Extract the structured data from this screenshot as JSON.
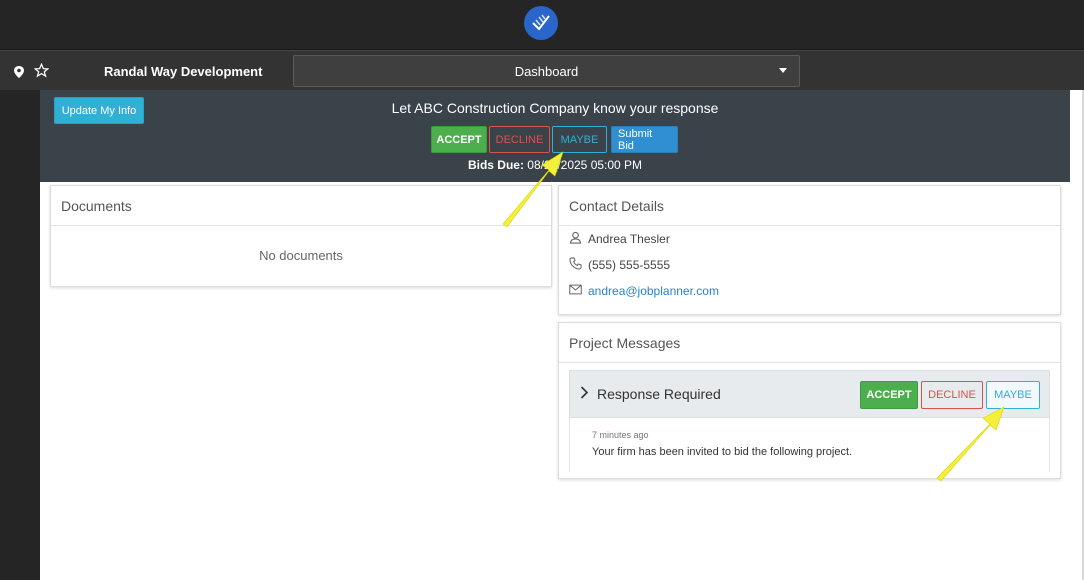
{
  "header": {
    "project_name": "Randal Way Development",
    "view_selected": "Dashboard"
  },
  "banner": {
    "update_label": "Update My Info",
    "title": "Let ABC Construction Company know your response",
    "accept_label": "ACCEPT",
    "decline_label": "DECLINE",
    "maybe_label": "MAYBE",
    "submit_label": "Submit Bid",
    "bids_due_label": "Bids Due:",
    "bids_due_value": "08/2_/2025 05:00 PM"
  },
  "documents": {
    "title": "Documents",
    "empty_text": "No documents"
  },
  "contact": {
    "title": "Contact Details",
    "name": "Andrea Thesler",
    "phone": "(555) 555-5555",
    "email": "andrea@jobplanner.com"
  },
  "messages": {
    "title": "Project Messages",
    "item_title": "Response Required",
    "accept_label": "ACCEPT",
    "decline_label": "DECLINE",
    "maybe_label": "MAYBE",
    "time": "7 minutes ago",
    "text": "Your firm has been invited to bid the following project."
  },
  "colors": {
    "accent": "#31b0d5",
    "accept": "#4cae4c",
    "decline": "#d9534f",
    "annotation_arrow": "#f4ef3a"
  }
}
